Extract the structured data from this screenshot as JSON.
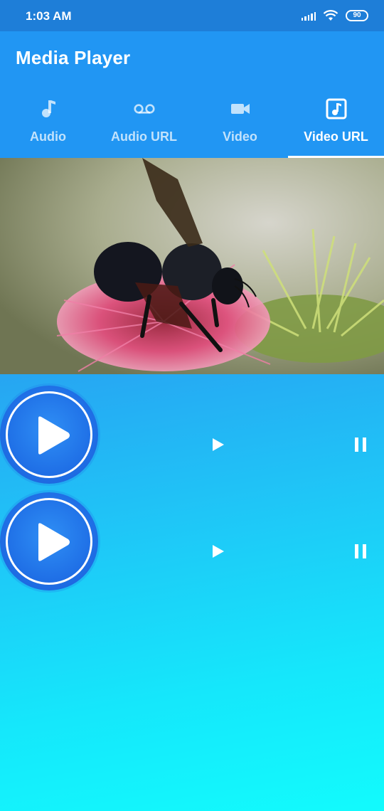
{
  "status_bar": {
    "time": "1:03 AM",
    "battery": "90",
    "icons": [
      "signal-icon",
      "wifi-icon",
      "battery-icon"
    ]
  },
  "app_bar": {
    "title": "Media Player",
    "color": "#2196f3"
  },
  "tabs": [
    {
      "label": "Audio",
      "icon": "music-note-icon",
      "active": false
    },
    {
      "label": "Audio URL",
      "icon": "voicemail-icon",
      "active": false
    },
    {
      "label": "Video",
      "icon": "videocam-icon",
      "active": false
    },
    {
      "label": "Video URL",
      "icon": "music-box-icon",
      "active": true
    }
  ],
  "video": {
    "description_icon": "video-frame"
  },
  "players": [
    {
      "big_icon": "play-circle-icon",
      "play_icon": "play-icon",
      "pause_icon": "pause-icon"
    },
    {
      "big_icon": "play-circle-icon",
      "play_icon": "play-icon",
      "pause_icon": "pause-icon"
    }
  ]
}
